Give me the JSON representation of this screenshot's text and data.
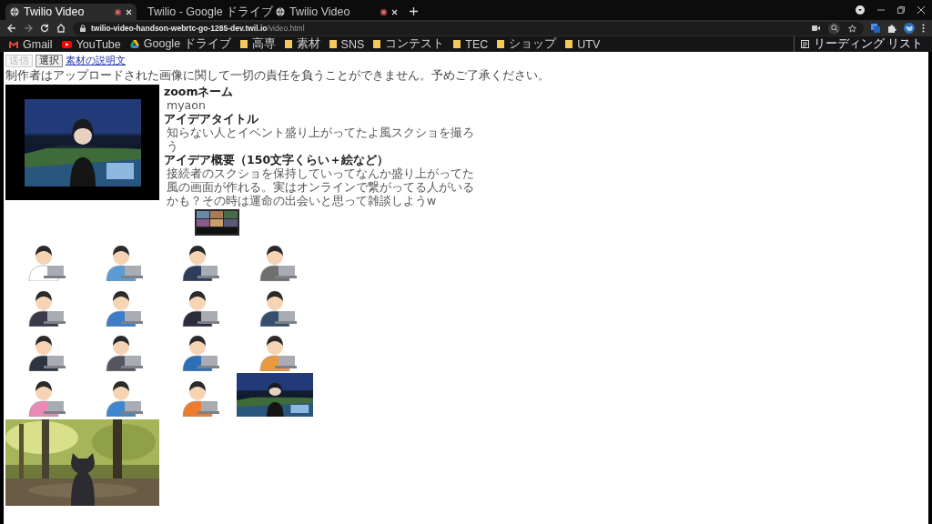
{
  "tabs": [
    {
      "title": "Twilio Video",
      "selected": true,
      "recording": true
    },
    {
      "title": "Twilio - Google ドライブ",
      "selected": false,
      "recording": false
    },
    {
      "title": "Twilio Video",
      "selected": false,
      "recording": true
    }
  ],
  "address": {
    "host": "twilio-video-handson-webrtc-go-1285-dev.twil.io",
    "path": "/video.html"
  },
  "bookmarks": [
    {
      "label": "Gmail",
      "kind": "gmail"
    },
    {
      "label": "YouTube",
      "kind": "youtube"
    },
    {
      "label": "Google ドライブ",
      "kind": "drive"
    },
    {
      "label": "高専",
      "kind": "folder"
    },
    {
      "label": "素材",
      "kind": "folder"
    },
    {
      "label": "SNS",
      "kind": "folder"
    },
    {
      "label": "コンテスト",
      "kind": "folder"
    },
    {
      "label": "TEC",
      "kind": "folder"
    },
    {
      "label": "ショップ",
      "kind": "folder"
    },
    {
      "label": "UTV",
      "kind": "folder"
    }
  ],
  "reading_list": "リーディング リスト",
  "page": {
    "buttons": [
      {
        "label": "送信",
        "disabled": true
      },
      {
        "label": "選択",
        "disabled": false
      }
    ],
    "link": "素材の説明文",
    "notice": "制作者はアップロードされた画像に関して一切の責任を負うことができません。予めご了承ください。",
    "fields": [
      {
        "label": "zoomネーム",
        "value": "myaon"
      },
      {
        "label": "アイデアタイトル",
        "value": "知らない人とイベント盛り上がってたよ風スクショを撮ろう"
      },
      {
        "label": "アイデア概要（150文字くらい＋絵など）",
        "value": "接続者のスクショを保持していってなんか盛り上がってた風の画面が作れる。実はオンラインで繋がってる人がいるかも？その時は運命の出会いと思って雑談しようw"
      }
    ],
    "tiles": [
      {
        "kind": "person"
      },
      {
        "kind": "person"
      },
      {
        "kind": "person"
      },
      {
        "kind": "person"
      },
      {
        "kind": "person"
      },
      {
        "kind": "person"
      },
      {
        "kind": "person"
      },
      {
        "kind": "person"
      },
      {
        "kind": "person"
      },
      {
        "kind": "person"
      },
      {
        "kind": "person"
      },
      {
        "kind": "person"
      },
      {
        "kind": "person"
      },
      {
        "kind": "person"
      },
      {
        "kind": "person"
      },
      {
        "kind": "video"
      }
    ]
  }
}
